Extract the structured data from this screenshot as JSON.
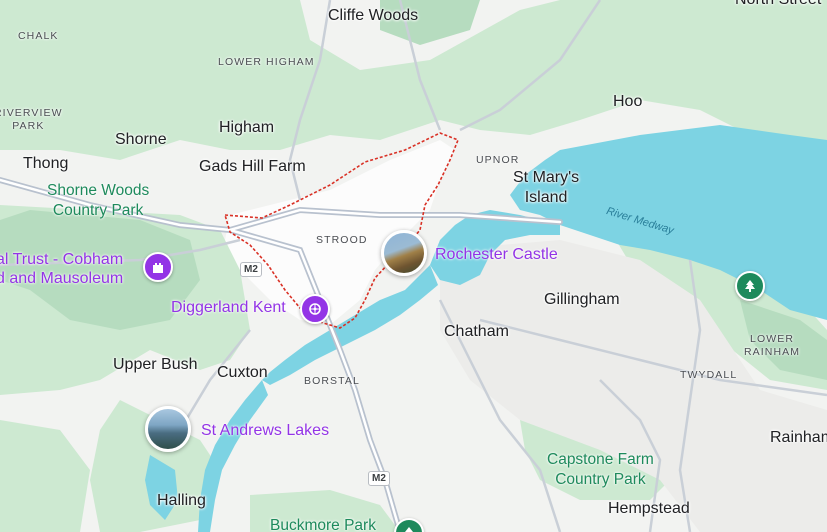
{
  "colors": {
    "land": "#f2f3f1",
    "green": "#cde9d1",
    "darkgreen": "#b6dcbf",
    "water": "#7dd3e3",
    "road_major": "#b8c1ce",
    "poi": "#9334e6",
    "park_text": "#1e8a5c",
    "boundary": "#d93025"
  },
  "places": {
    "cliffe_woods": "Cliffe Woods",
    "north_street": "North Street",
    "chalk": "CHALK",
    "lower_higham": "LOWER HIGHAM",
    "riverview_park": "RIVERVIEW\nPARK",
    "hoo": "Hoo",
    "shorne": "Shorne",
    "higham": "Higham",
    "thong": "Thong",
    "gads_hill_farm": "Gads Hill Farm",
    "upnor": "UPNOR",
    "st_marys_island": "St Mary's\nIsland",
    "strood": "STROOD",
    "gillingham": "Gillingham",
    "chatham": "Chatham",
    "lower_rainham": "LOWER\nRAINHAM",
    "upper_bush": "Upper Bush",
    "cuxton": "Cuxton",
    "borstal": "BORSTAL",
    "twydall": "TWYDALL",
    "rainham": "Rainham",
    "halling": "Halling",
    "hempstead": "Hempstead"
  },
  "parks": {
    "shorne_woods": "Shorne Woods\nCountry Park",
    "capstone_farm": "Capstone Farm\nCountry Park",
    "buckmore_park": "Buckmore Park"
  },
  "pois": {
    "cobham": "al Trust - Cobham\nd and Mausoleum",
    "diggerland": "Diggerland Kent",
    "rochester_castle": "Rochester Castle",
    "st_andrews_lakes": "St Andrews Lakes"
  },
  "water_labels": {
    "river_medway": "River Medway"
  },
  "road_shields": {
    "m2_west": "M2",
    "m2_south": "M2"
  },
  "icons": {
    "tree": "tree-icon",
    "castle": "castle-icon",
    "amusement": "amusement-park-icon"
  }
}
